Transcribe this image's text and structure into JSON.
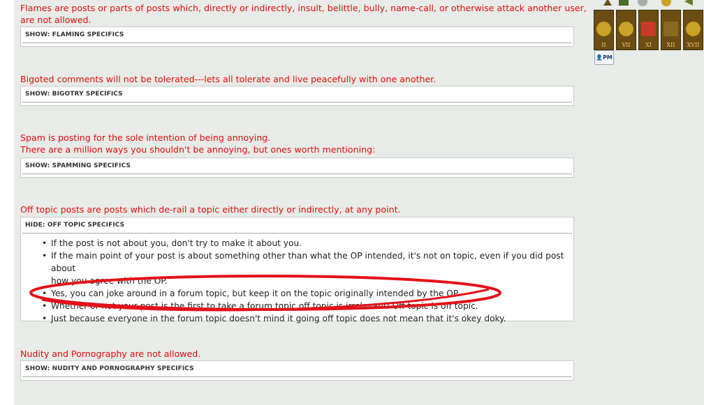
{
  "sections": [
    {
      "lines": [
        "Flames are posts or parts of posts which, directly or indirectly, insult, belittle, bully, name-call, or otherwise attack another user, and",
        "are not allowed."
      ],
      "spoiler_label": "SHOW: FLAMING SPECIFICS"
    },
    {
      "lines": [
        "Bigoted comments will not be tolerated---lets all tolerate and live peacefully with one another."
      ],
      "spoiler_label": "SHOW: BIGOTRY SPECIFICS"
    },
    {
      "lines": [
        "Spam is posting for the sole intention of being annoying.",
        "There are a million ways you shouldn't be annoying, but ones worth mentioning:"
      ],
      "spoiler_label": "SHOW: SPAMMING SPECIFICS"
    },
    {
      "lines": [
        "Off topic posts are posts which de-rail a topic either directly or indirectly, at any point."
      ],
      "spoiler_label": "HIDE: OFF TOPIC SPECIFICS",
      "items": [
        "If the post is not about you, don't try to make it about you.",
        "If the main point of your post is about something other than what the OP intended, it's not on topic, even if you did post about",
        "how you agree with the OP.",
        "Yes, you can joke around in a forum topic, but keep it on the topic originally intended by the OP.",
        "Whether or not your post is the first to take a forum topic off topic is irrelevant: Off topic is off topic.",
        "Just because everyone in the forum topic doesn't mind it going off topic does not mean that it's okey doky."
      ]
    },
    {
      "lines": [
        "Nudity and Pornography are not allowed."
      ],
      "spoiler_label": "SHOW: NUDITY AND PORNOGRAPHY SPECIFICS"
    }
  ],
  "sidebar": {
    "medals": [
      "II",
      "VII",
      "XI",
      "XII",
      "XVII"
    ],
    "pm_label": "PM"
  },
  "colors": {
    "rule_text": "#e01010",
    "background": "#e8ebe7",
    "annotation_oval": "#e3121a",
    "medal": "#6b4d14"
  },
  "icons": [
    "trophy-icon",
    "star-medal-icon",
    "shield-medal-icon",
    "plaque-icon",
    "pm-icon"
  ]
}
